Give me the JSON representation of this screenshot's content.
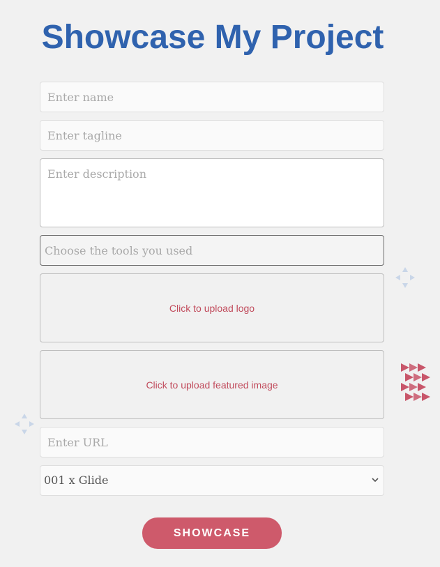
{
  "page": {
    "title": "Showcase My Project"
  },
  "form": {
    "name_placeholder": "Enter name",
    "tagline_placeholder": "Enter tagline",
    "description_placeholder": "Enter description",
    "tools_placeholder": "Choose the tools you used",
    "logo_upload_label": "Click to upload logo",
    "featured_upload_label": "Click to upload featured image",
    "url_placeholder": "Enter URL",
    "project_select": {
      "selected": "001 x Glide"
    },
    "submit_label": "SHOWCASE"
  },
  "colors": {
    "title": "#2f62ae",
    "accent": "#ce5a6b",
    "upload_text": "#c14b5c",
    "background": "#f1f1f1"
  },
  "icons": {
    "select": "chevron-down-icon",
    "decor_right": "triangle-pattern-icon",
    "decor_small": "diamond-arrows-icon"
  }
}
